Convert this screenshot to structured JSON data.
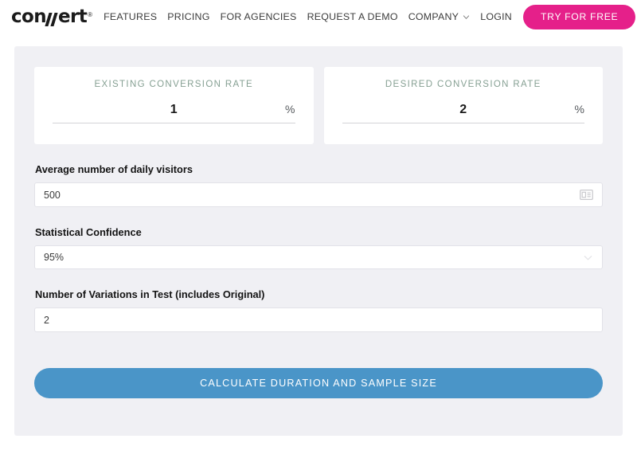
{
  "nav": {
    "logo": {
      "text_before": "con",
      "mark": "double-slash-v",
      "text_after": "ert",
      "registered": "®"
    },
    "links": [
      {
        "label": "FEATURES",
        "name": "nav-link-features"
      },
      {
        "label": "PRICING",
        "name": "nav-link-pricing"
      },
      {
        "label": "FOR AGENCIES",
        "name": "nav-link-for-agencies"
      },
      {
        "label": "REQUEST A DEMO",
        "name": "nav-link-request-a-demo"
      },
      {
        "label": "COMPANY",
        "name": "nav-link-company"
      },
      {
        "label": "LOGIN",
        "name": "nav-link-login"
      }
    ],
    "cta_label": "TRY FOR FREE",
    "cta_color": "#e5208a",
    "text_color": "#3c3c3c"
  },
  "calculator": {
    "panel_bg": "#f0f0f4",
    "rate_cards": [
      {
        "label": "EXISTING CONVERSION RATE",
        "value": "1",
        "unit": "%",
        "label_color": "#86a093"
      },
      {
        "label": "DESIRED CONVERSION RATE",
        "value": "2",
        "unit": "%",
        "label_color": "#86a093"
      }
    ],
    "visitors": {
      "label": "Average number of daily visitors",
      "value": "500",
      "placeholder": "Average number of daily visitors",
      "icon": "contact-card-icon"
    },
    "confidence": {
      "label": "Statistical Confidence",
      "value": "95%",
      "options": [
        "95%"
      ],
      "icon": "chevron-down-icon"
    },
    "variations": {
      "label": "Number of Variations in Test (includes Original)",
      "value": "2",
      "placeholder": "Number of Variations in Test (includes Original)"
    },
    "submit": {
      "label": "CALCULATE DURATION AND SAMPLE SIZE",
      "color": "#4a95c8"
    }
  }
}
